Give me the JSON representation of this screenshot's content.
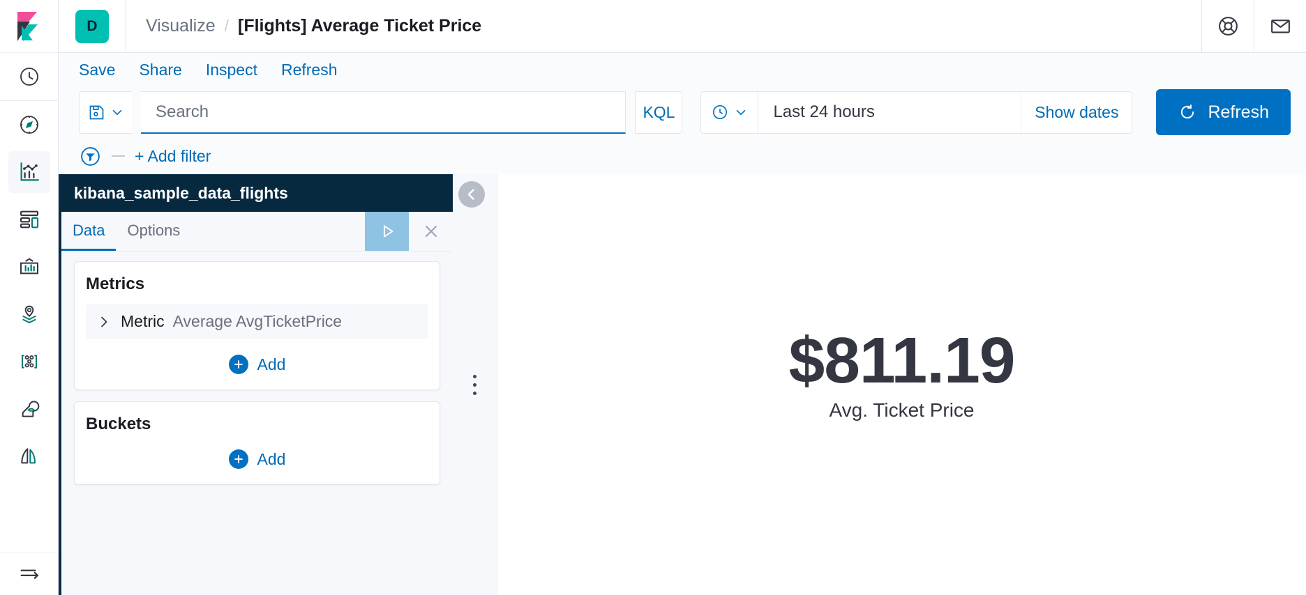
{
  "header": {
    "logo_icon": "kibana-logo",
    "app_badge": "D",
    "breadcrumb_parent": "Visualize",
    "breadcrumb_separator": "/",
    "breadcrumb_current": "[Flights] Average Ticket Price",
    "help_icon": "lifebuoy-icon",
    "mail_icon": "envelope-icon"
  },
  "sidebar": {
    "items": [
      {
        "name": "recently-viewed",
        "icon": "clock-icon",
        "active": false
      },
      {
        "name": "discover",
        "icon": "compass-icon",
        "active": false
      },
      {
        "name": "visualize",
        "icon": "visualize-chart-icon",
        "active": true
      },
      {
        "name": "dashboard",
        "icon": "dashboard-grid-icon",
        "active": false
      },
      {
        "name": "canvas",
        "icon": "canvas-frame-icon",
        "active": false
      },
      {
        "name": "maps",
        "icon": "map-pin-layers-icon",
        "active": false
      },
      {
        "name": "graph",
        "icon": "graph-nodes-icon",
        "active": false
      },
      {
        "name": "machine-learning",
        "icon": "machine-learning-icon",
        "active": false
      },
      {
        "name": "apm",
        "icon": "apm-sails-icon",
        "active": false
      }
    ],
    "collapse_icon": "collapse-arrow-icon"
  },
  "actions": {
    "save": "Save",
    "share": "Share",
    "inspect": "Inspect",
    "refresh": "Refresh"
  },
  "query": {
    "saved_query_icon": "floppy-disk-icon",
    "saved_query_chevron": "chevron-down-icon",
    "search_value": "",
    "search_placeholder": "Search",
    "language": "KQL",
    "date_icon": "clock-icon",
    "date_chevron": "chevron-down-icon",
    "time_range": "Last 24 hours",
    "show_dates": "Show dates",
    "refresh_button": "Refresh",
    "refresh_icon": "refresh-circle-icon"
  },
  "filters": {
    "filter_icon": "filter-funnel-icon",
    "add_filter": "+ Add filter"
  },
  "editor": {
    "index_pattern": "kibana_sample_data_flights",
    "tabs": [
      {
        "label": "Data",
        "active": true
      },
      {
        "label": "Options",
        "active": false
      }
    ],
    "apply_icon": "play-triangle-icon",
    "close_icon": "close-x-icon",
    "metrics": {
      "title": "Metrics",
      "rows": [
        {
          "expand_icon": "chevron-right-icon",
          "label": "Metric",
          "value": "Average AvgTicketPrice"
        }
      ],
      "add_label": "Add",
      "add_icon": "plus-circle-icon"
    },
    "buckets": {
      "title": "Buckets",
      "add_label": "Add",
      "add_icon": "plus-circle-icon"
    }
  },
  "visualization": {
    "metric_value": "$811.19",
    "metric_label": "Avg. Ticket Price"
  },
  "colors": {
    "primary_blue": "#0071c2",
    "link_blue": "#006bb4",
    "teal": "#00bfb3",
    "dark_navy": "#07293f",
    "text_dark": "#343741"
  }
}
